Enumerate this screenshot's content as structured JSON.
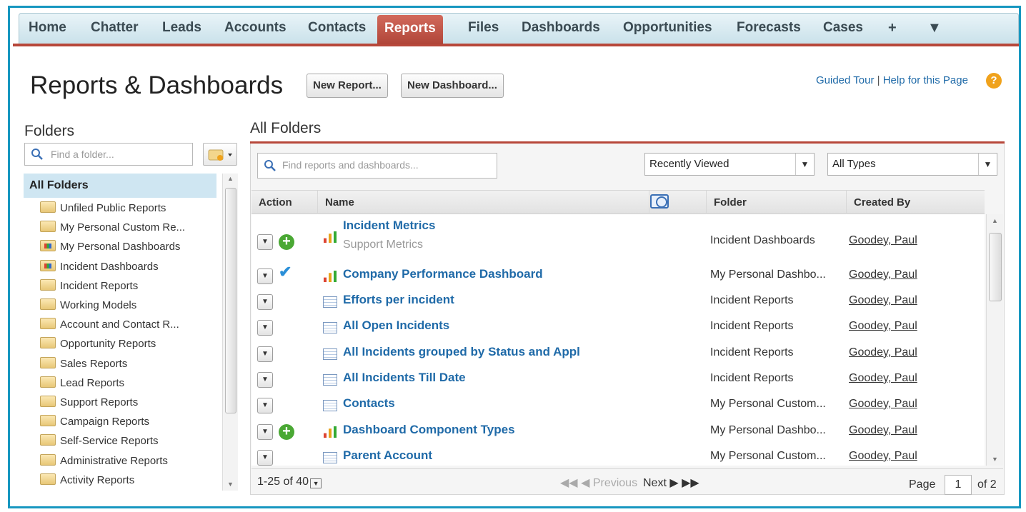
{
  "tabs": [
    "Home",
    "Chatter",
    "Leads",
    "Accounts",
    "Contacts",
    "Reports",
    "Files",
    "Dashboards",
    "Opportunities",
    "Forecasts",
    "Cases",
    "+",
    "▼"
  ],
  "active_tab": "Reports",
  "header": {
    "title": "Reports & Dashboards",
    "new_report": "New Report...",
    "new_dashboard": "New Dashboard...",
    "guided_tour": "Guided Tour",
    "separator": "|",
    "help": "Help for this Page",
    "help_icon": "?"
  },
  "sidebar": {
    "heading": "Folders",
    "search_placeholder": "Find a folder...",
    "all_folders": "All Folders",
    "folders": [
      {
        "label": "Unfiled Public Reports",
        "icon": "folder-icon"
      },
      {
        "label": "My Personal Custom Re...",
        "icon": "folder-icon"
      },
      {
        "label": "My Personal Dashboards",
        "icon": "dashboard-folder-icon"
      },
      {
        "label": "Incident Dashboards",
        "icon": "dashboard-folder-icon"
      },
      {
        "label": "Incident Reports",
        "icon": "folder-icon"
      },
      {
        "label": "Working Models",
        "icon": "folder-icon"
      },
      {
        "label": "Account and Contact R...",
        "icon": "folder-icon"
      },
      {
        "label": "Opportunity Reports",
        "icon": "folder-icon"
      },
      {
        "label": "Sales Reports",
        "icon": "folder-icon"
      },
      {
        "label": "Lead Reports",
        "icon": "folder-icon"
      },
      {
        "label": "Support Reports",
        "icon": "folder-icon"
      },
      {
        "label": "Campaign Reports",
        "icon": "folder-icon"
      },
      {
        "label": "Self-Service Reports",
        "icon": "folder-icon"
      },
      {
        "label": "Administrative Reports",
        "icon": "folder-icon"
      },
      {
        "label": "Activity Reports",
        "icon": "folder-icon"
      }
    ]
  },
  "main": {
    "heading": "All Folders",
    "search_placeholder": "Find reports and dashboards...",
    "view_filter": "Recently Viewed",
    "type_filter": "All Types",
    "columns": {
      "action": "Action",
      "name": "Name",
      "folder": "Folder",
      "created_by": "Created By"
    },
    "rows": [
      {
        "status": "plus",
        "type": "dashboard",
        "name": "Incident Metrics",
        "sub": "Support Metrics",
        "folder": "Incident Dashboards",
        "created_by": "Goodey, Paul"
      },
      {
        "status": "check",
        "type": "dashboard",
        "name": "Company Performance Dashboard",
        "sub": "",
        "folder": "My Personal Dashbo...",
        "created_by": "Goodey, Paul"
      },
      {
        "status": "",
        "type": "report",
        "name": "Efforts per incident",
        "sub": "",
        "folder": "Incident Reports",
        "created_by": "Goodey, Paul"
      },
      {
        "status": "",
        "type": "report",
        "name": "All Open Incidents",
        "sub": "",
        "folder": "Incident Reports",
        "created_by": "Goodey, Paul"
      },
      {
        "status": "",
        "type": "report",
        "name": "All Incidents grouped by Status and Appl",
        "sub": "",
        "folder": "Incident Reports",
        "created_by": "Goodey, Paul"
      },
      {
        "status": "",
        "type": "report",
        "name": "All Incidents Till Date",
        "sub": "",
        "folder": "Incident Reports",
        "created_by": "Goodey, Paul"
      },
      {
        "status": "",
        "type": "report",
        "name": "Contacts",
        "sub": "",
        "folder": "My Personal Custom...",
        "created_by": "Goodey, Paul"
      },
      {
        "status": "plus",
        "type": "dashboard",
        "name": "Dashboard Component Types",
        "sub": "",
        "folder": "My Personal Dashbo...",
        "created_by": "Goodey, Paul"
      },
      {
        "status": "",
        "type": "report",
        "name": "Parent Account",
        "sub": "",
        "folder": "My Personal Custom...",
        "created_by": "Goodey, Paul"
      }
    ],
    "pager": {
      "count": "1-25 of 40",
      "previous": "Previous",
      "next": "Next",
      "page_label": "Page",
      "page": "1",
      "of": "of 2"
    }
  }
}
